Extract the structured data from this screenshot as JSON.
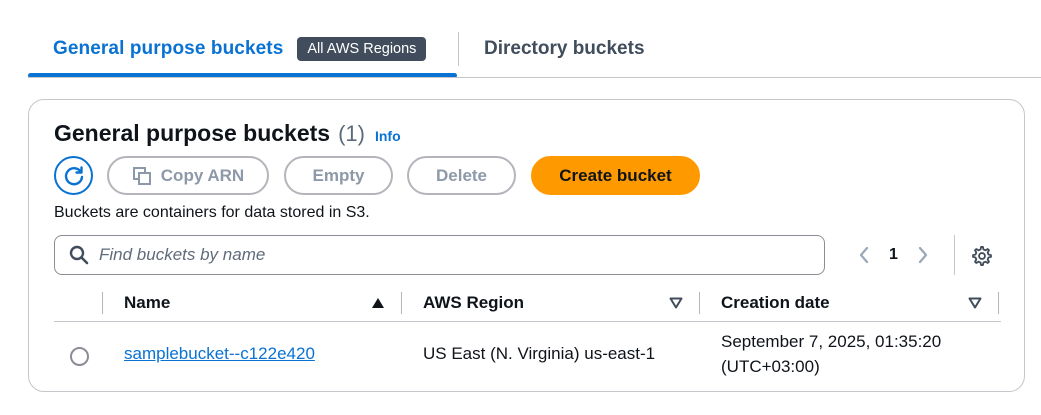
{
  "tabs": {
    "active_label": "General purpose buckets",
    "badge": "All AWS Regions",
    "inactive_label": "Directory buckets"
  },
  "panel": {
    "title": "General purpose buckets",
    "count": "(1)",
    "info_link": "Info",
    "description": "Buckets are containers for data stored in S3."
  },
  "actions": {
    "refresh_icon": "refresh-icon",
    "copy_arn": "Copy ARN",
    "empty": "Empty",
    "delete": "Delete",
    "create": "Create bucket"
  },
  "search": {
    "placeholder": "Find buckets by name",
    "value": ""
  },
  "pagination": {
    "current_page": "1"
  },
  "table": {
    "columns": [
      "Name",
      "AWS Region",
      "Creation date"
    ],
    "rows": [
      {
        "name": "samplebucket--c122e420",
        "region": "US East (N. Virginia) us-east-1",
        "created_line1": "September 7, 2025, 01:35:20",
        "created_line2": "(UTC+03:00)"
      }
    ]
  },
  "colors": {
    "accent": "#0972d3",
    "primary_button": "#ff9900",
    "badge_bg": "#414d5c"
  }
}
